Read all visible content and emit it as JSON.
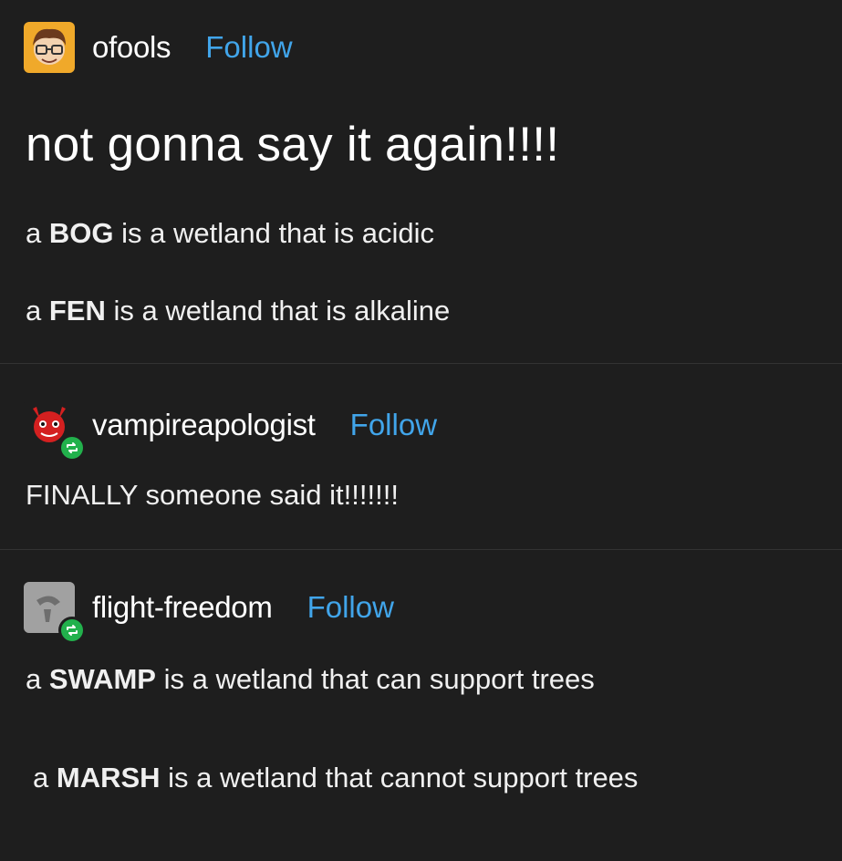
{
  "posts": [
    {
      "username": "ofools",
      "follow_label": "Follow",
      "avatar_icon": "face-with-glasses-avatar-icon",
      "title": "not gonna say it again!!!!",
      "lines": [
        {
          "article": "a",
          "keyword": "BOG",
          "rest": "is a wetland that is acidic"
        },
        {
          "article": "a",
          "keyword": "FEN",
          "rest": "is a wetland that is alkaline"
        }
      ]
    },
    {
      "username": "vampireapologist",
      "follow_label": "Follow",
      "avatar_icon": "red-devil-avatar-icon",
      "reblog_icon": "reblog-icon",
      "text": "FINALLY someone said it!!!!!!!"
    },
    {
      "username": "flight-freedom",
      "follow_label": "Follow",
      "avatar_icon": "grey-default-avatar-icon",
      "reblog_icon": "reblog-icon",
      "lines": [
        {
          "article": "a",
          "keyword": "SWAMP",
          "rest": "is a wetland that can support trees"
        },
        {
          "article": "a",
          "keyword": "MARSH",
          "rest": "is a wetland that cannot support trees"
        }
      ]
    }
  ],
  "colors": {
    "background": "#1e1e1e",
    "text": "#f2f2f2",
    "follow": "#41a5ea",
    "reblog_badge": "#22b14c",
    "divider": "#333333"
  }
}
